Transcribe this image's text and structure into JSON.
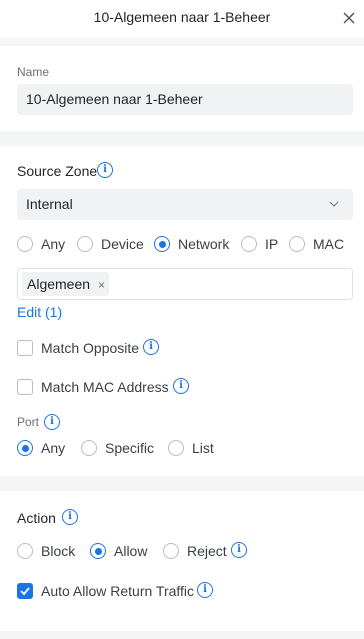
{
  "header": {
    "title": "10-Algemeen naar 1-Beheer"
  },
  "name": {
    "label": "Name",
    "value": "10-Algemeen naar 1-Beheer"
  },
  "source_zone": {
    "title": "Source Zone",
    "selected": "Internal",
    "type_options": [
      "Any",
      "Device",
      "Network",
      "IP",
      "MAC"
    ],
    "type_selected": "Network",
    "tags": [
      {
        "label": "Algemeen",
        "remove": "×"
      }
    ],
    "edit_link": "Edit (1)",
    "match_opposite": "Match Opposite",
    "match_mac": "Match MAC Address"
  },
  "port": {
    "label": "Port",
    "options": [
      "Any",
      "Specific",
      "List"
    ],
    "selected": "Any"
  },
  "action": {
    "title": "Action",
    "options": [
      "Block",
      "Allow",
      "Reject"
    ],
    "selected": "Allow",
    "auto_allow": "Auto Allow Return Traffic",
    "auto_allow_checked": true
  },
  "colors": {
    "accent": "#1a73e8",
    "background": "#f4f5f7"
  }
}
